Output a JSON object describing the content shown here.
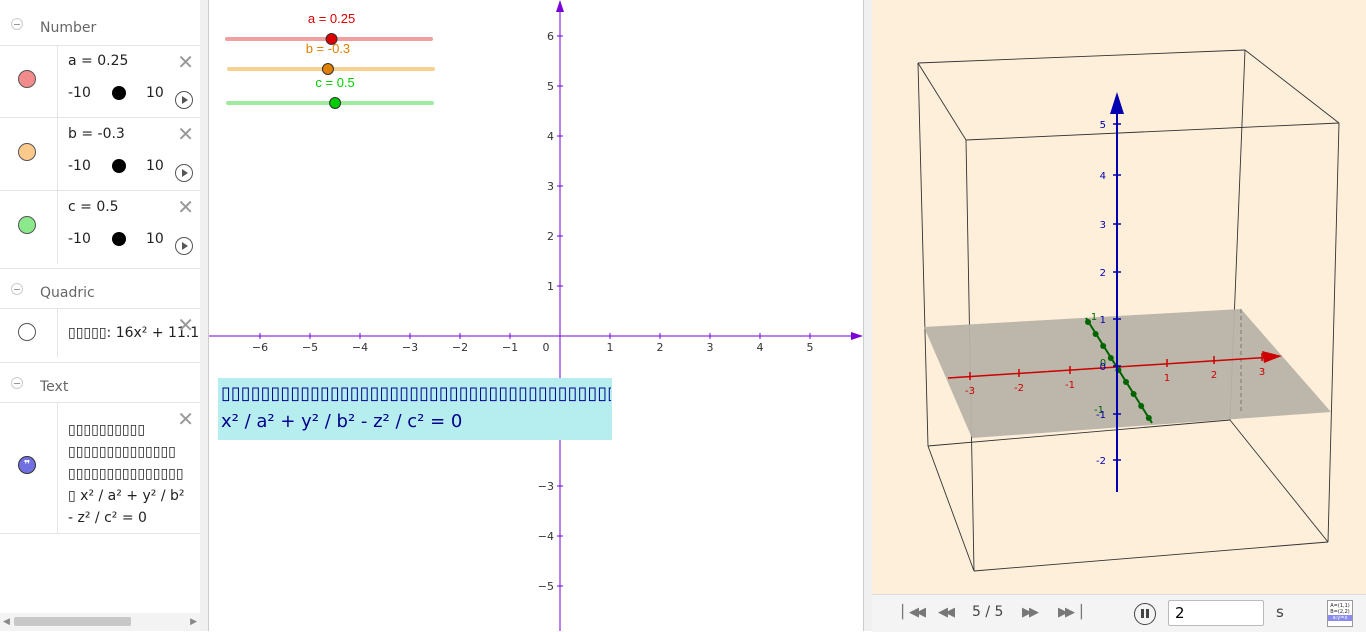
{
  "algebra": {
    "groups": {
      "number": "Number",
      "quadric": "Quadric",
      "text": "Text"
    },
    "numbers": [
      {
        "label": "a = 0.25",
        "min": "-10",
        "max": "10",
        "color": "#f28b8b"
      },
      {
        "label": "b = -0.3",
        "min": "-10",
        "max": "10",
        "color": "#fbc98c"
      },
      {
        "label": "c = 0.5",
        "min": "-10",
        "max": "10",
        "color": "#8be88b"
      }
    ],
    "quadric": {
      "label": "▯▯▯▯▯: 16x² + 11.1"
    },
    "text_item": {
      "lines": [
        "▯▯▯▯▯▯▯▯▯▯",
        "▯▯▯▯▯▯▯▯▯▯▯▯▯▯",
        "▯▯▯▯▯▯▯▯▯▯▯▯▯▯▯",
        "▯ x² / a² + y² / b²",
        "- z² / c² = 0"
      ],
      "icon_color": "#7070e0"
    }
  },
  "graphics": {
    "sliders": [
      {
        "label": "a = 0.25",
        "color": "#dd0000",
        "track": "#f0a0a0",
        "value": 0.25
      },
      {
        "label": "b = -0.3",
        "color": "#e08000",
        "track": "#f8d090",
        "value": -0.3
      },
      {
        "label": "c = 0.5",
        "color": "#00cc00",
        "track": "#a0eaa0",
        "value": 0.5
      }
    ],
    "x_ticks": [
      "−6",
      "−5",
      "−4",
      "−3",
      "−2",
      "−1",
      "0",
      "1",
      "2",
      "3",
      "4",
      "5"
    ],
    "y_ticks_pos": [
      "6",
      "5",
      "4",
      "3",
      "2",
      "1"
    ],
    "y_ticks_neg": [
      "−3",
      "−4",
      "−5"
    ],
    "axis_color": "#7a00d6",
    "text_box": {
      "line1": "▯▯▯▯▯▯▯▯▯▯▯▯▯▯▯▯▯▯▯▯▯▯▯▯▯▯▯▯▯▯▯▯▯▯▯▯▯▯▯▯▯▯▯▯",
      "line2": "x² / a² + y² / b² - z² / c² = 0"
    }
  },
  "view3d": {
    "x_ticks": [
      "-3",
      "-2",
      "-1",
      "1",
      "2",
      "3"
    ],
    "y_ticks": [
      "1",
      "0",
      "-1"
    ],
    "z_ticks": [
      "5",
      "4",
      "3",
      "2",
      "1",
      "0",
      "-1",
      "-2"
    ],
    "colors": {
      "x": "#cc0000",
      "y": "#006400",
      "z": "#0000b0",
      "plane": "#b9b2a8",
      "bg": "#fdefd9"
    }
  },
  "toolbar": {
    "step": "5 / 5",
    "speed_value": "2",
    "speed_unit": "s",
    "alg_icon": {
      "line1": "A=(1,1)",
      "line2": "B=(2,2)",
      "line3": "a:y=x"
    }
  }
}
